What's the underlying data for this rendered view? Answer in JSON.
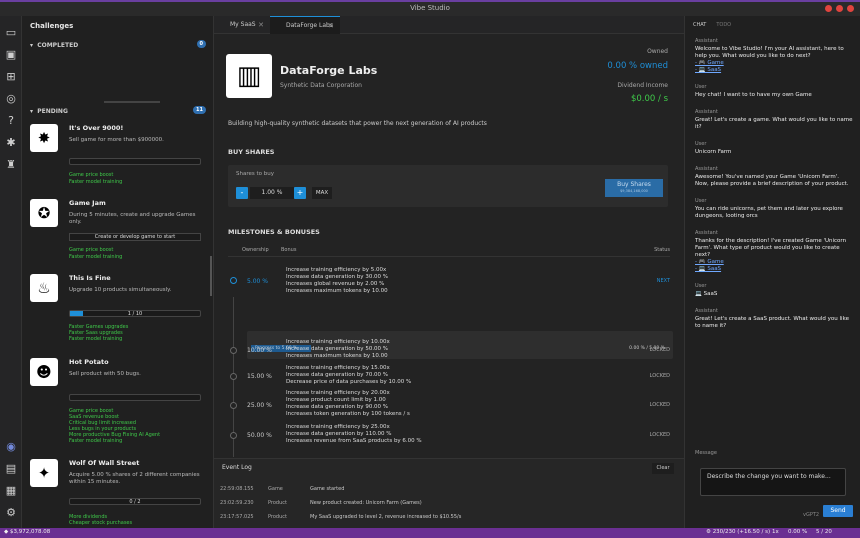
{
  "window": {
    "title": "Vibe Studio"
  },
  "challenges": {
    "title": "Challenges",
    "completed": {
      "label": "COMPLETED",
      "count": "0"
    },
    "pending": {
      "label": "PENDING",
      "count": "11"
    },
    "items": [
      {
        "title": "It's Over 9000!",
        "desc": "Sell game for more than $900000.",
        "rewards": [
          "Game price boost",
          "Faster model training"
        ]
      },
      {
        "title": "Game Jam",
        "desc": "During 5 minutes, create and upgrade Games only.",
        "button": "Create or develop game to start",
        "rewards": [
          "Game price boost",
          "Faster model training"
        ]
      },
      {
        "title": "This Is Fine",
        "desc": "Upgrade 10 products simultaneously.",
        "progress": "1 / 10",
        "progress_value": 0.1,
        "rewards": [
          "Faster Games upgrades",
          "Faster Saas upgrades",
          "Faster model training"
        ]
      },
      {
        "title": "Hot Potato",
        "desc": "Sell product with 50 bugs.",
        "rewards": [
          "Game price boost",
          "SaaS revenue boost",
          "Critical bug limit increased",
          "Less bugs in your products",
          "More productive Bug Fixing AI Agent",
          "Faster model training"
        ]
      },
      {
        "title": "Wolf Of Wall Street",
        "desc": "Acquire 5.00 % shares of 2 different companies within 15 minutes.",
        "progress": "0 / 2",
        "progress_value": 0,
        "rewards": [
          "More dividends",
          "Cheaper stock purchases"
        ]
      }
    ]
  },
  "tabs": [
    {
      "label": "My SaaS"
    },
    {
      "label": "DataForge Labs"
    }
  ],
  "company": {
    "name": "DataForge Labs",
    "subtitle": "Synthetic Data Corporation",
    "owned_label": "Owned",
    "owned_value": "0.00 % owned",
    "dividend_label": "Dividend Income",
    "dividend_value": "$0.00 / s",
    "tagline": "Building high-quality synthetic datasets that power the next generation of AI products",
    "buy": {
      "title": "BUY SHARES",
      "label": "Shares to buy",
      "minus": "-",
      "value": "1.00 %",
      "plus": "+",
      "max": "MAX",
      "button": "Buy Shares",
      "button_sub": "$9,384,168,000"
    },
    "milestones": {
      "title": "MILESTONES & BONUSES",
      "col_ownership": "Ownership",
      "col_bonus": "Bonus",
      "col_status": "Status",
      "progress_label": "Progress to 5.00 %",
      "progress_right": "0.00 % / 5.00 %",
      "rows": [
        {
          "pct": "5.00 %",
          "status": "NEXT",
          "bonuses": [
            "Increase training efficiency by 5.00x",
            "Increase data generation by 30.00 %",
            "Increases global revenue by 2.00 %",
            "Increases maximum tokens by 10.00"
          ]
        },
        {
          "pct": "10.00 %",
          "status": "LOCKED",
          "bonuses": [
            "Increase training efficiency by 10.00x",
            "Increase data generation by 50.00 %",
            "Increases maximum tokens by 10.00"
          ]
        },
        {
          "pct": "15.00 %",
          "status": "LOCKED",
          "bonuses": [
            "Increase training efficiency by 15.00x",
            "Increase data generation by 70.00 %",
            "Decrease price of data purchases by 10.00 %"
          ]
        },
        {
          "pct": "25.00 %",
          "status": "LOCKED",
          "bonuses": [
            "Increase training efficiency by 20.00x",
            "Increase product count limit by 1.00",
            "Increase data generation by 90.00 %",
            "Increases token generation by 100 tokens / s"
          ]
        },
        {
          "pct": "50.00 %",
          "status": "LOCKED",
          "bonuses": [
            "Increase training efficiency by 25.00x",
            "Increase data generation by 110.00 %",
            "Increases revenue from SaaS products by 6.00 %"
          ]
        }
      ]
    }
  },
  "event_log": {
    "title": "Event Log",
    "clear": "Clear",
    "rows": [
      {
        "time": "22:59:08.155",
        "type": "Game",
        "msg": "Game started"
      },
      {
        "time": "23:02:59.230",
        "type": "Product",
        "msg": "New product created: Unicorn Farm (Games)"
      },
      {
        "time": "23:17:57.025",
        "type": "Product",
        "msg": "My SaaS upgraded to level 2, revenue increased to $10.55/s"
      }
    ]
  },
  "chat": {
    "tab_chat": "CHAT",
    "tab_todo": "TODO",
    "messages": [
      {
        "role": "Assistant",
        "text": "Welcome to Vibe Studio! I'm your AI assistant, here to help you. What would you like to do next?",
        "links": [
          "- 🎮 Game",
          "- 💻 SaaS"
        ]
      },
      {
        "role": "User",
        "text": "Hey chat! I want to to have my own Game"
      },
      {
        "role": "Assistant",
        "text": "Great! Let's create a game. What would you like to name it?"
      },
      {
        "role": "User",
        "text": "Unicorn Farm"
      },
      {
        "role": "Assistant",
        "text": "Awesome! You've named your Game 'Unicorn Farm'. Now, please provide a brief description of your product."
      },
      {
        "role": "User",
        "text": "You can ride unicorns, pet them and later you explore dungeons, looting orcs"
      },
      {
        "role": "Assistant",
        "text": "Thanks for the description! I've created Game 'Unicorn Farm'. What type of product would you like to create next?",
        "links": [
          "- 🎮 Game",
          "- 💻 SaaS"
        ]
      },
      {
        "role": "User",
        "text": "💻 SaaS"
      },
      {
        "role": "Assistant",
        "text": "Great! Let's create a SaaS product. What would you like to name it?"
      }
    ],
    "message_label": "Message",
    "input_value": "Describe the change you want to make...",
    "model": "vGPT2",
    "send": "Send"
  },
  "status": {
    "money": "$3,972,078.08",
    "tokens": "230/230 (+16.50 / s)",
    "multiplier": "1x",
    "percent": "0.00 %",
    "pages": "5 / 20"
  }
}
